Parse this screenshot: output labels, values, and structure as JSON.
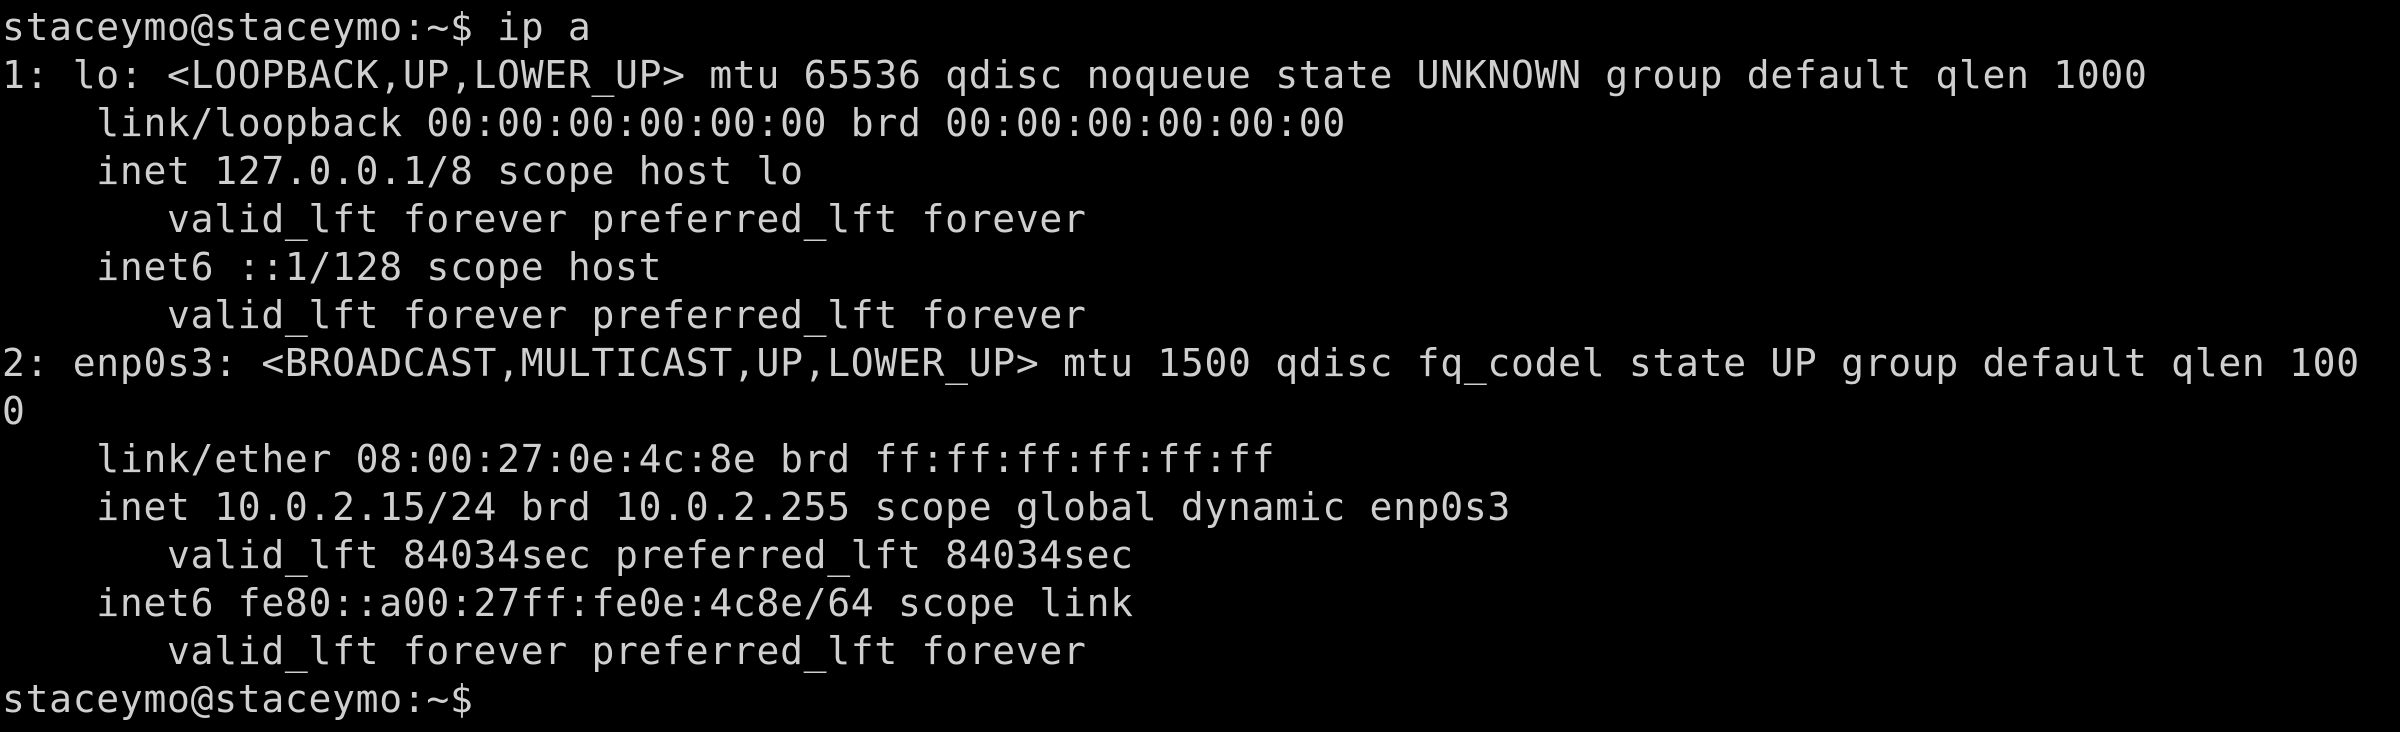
{
  "terminal": {
    "background": "#000000",
    "foreground": "#cfcfcf",
    "lines": [
      "staceymo@staceymo:~$ ip a",
      "1: lo: <LOOPBACK,UP,LOWER_UP> mtu 65536 qdisc noqueue state UNKNOWN group default qlen 1000",
      "    link/loopback 00:00:00:00:00:00 brd 00:00:00:00:00:00",
      "    inet 127.0.0.1/8 scope host lo",
      "       valid_lft forever preferred_lft forever",
      "    inet6 ::1/128 scope host",
      "       valid_lft forever preferred_lft forever",
      "2: enp0s3: <BROADCAST,MULTICAST,UP,LOWER_UP> mtu 1500 qdisc fq_codel state UP group default qlen 100",
      "0",
      "    link/ether 08:00:27:0e:4c:8e brd ff:ff:ff:ff:ff:ff",
      "    inet 10.0.2.15/24 brd 10.0.2.255 scope global dynamic enp0s3",
      "       valid_lft 84034sec preferred_lft 84034sec",
      "    inet6 fe80::a00:27ff:fe0e:4c8e/64 scope link",
      "       valid_lft forever preferred_lft forever"
    ],
    "prompt": "staceymo@staceymo:~$ "
  }
}
